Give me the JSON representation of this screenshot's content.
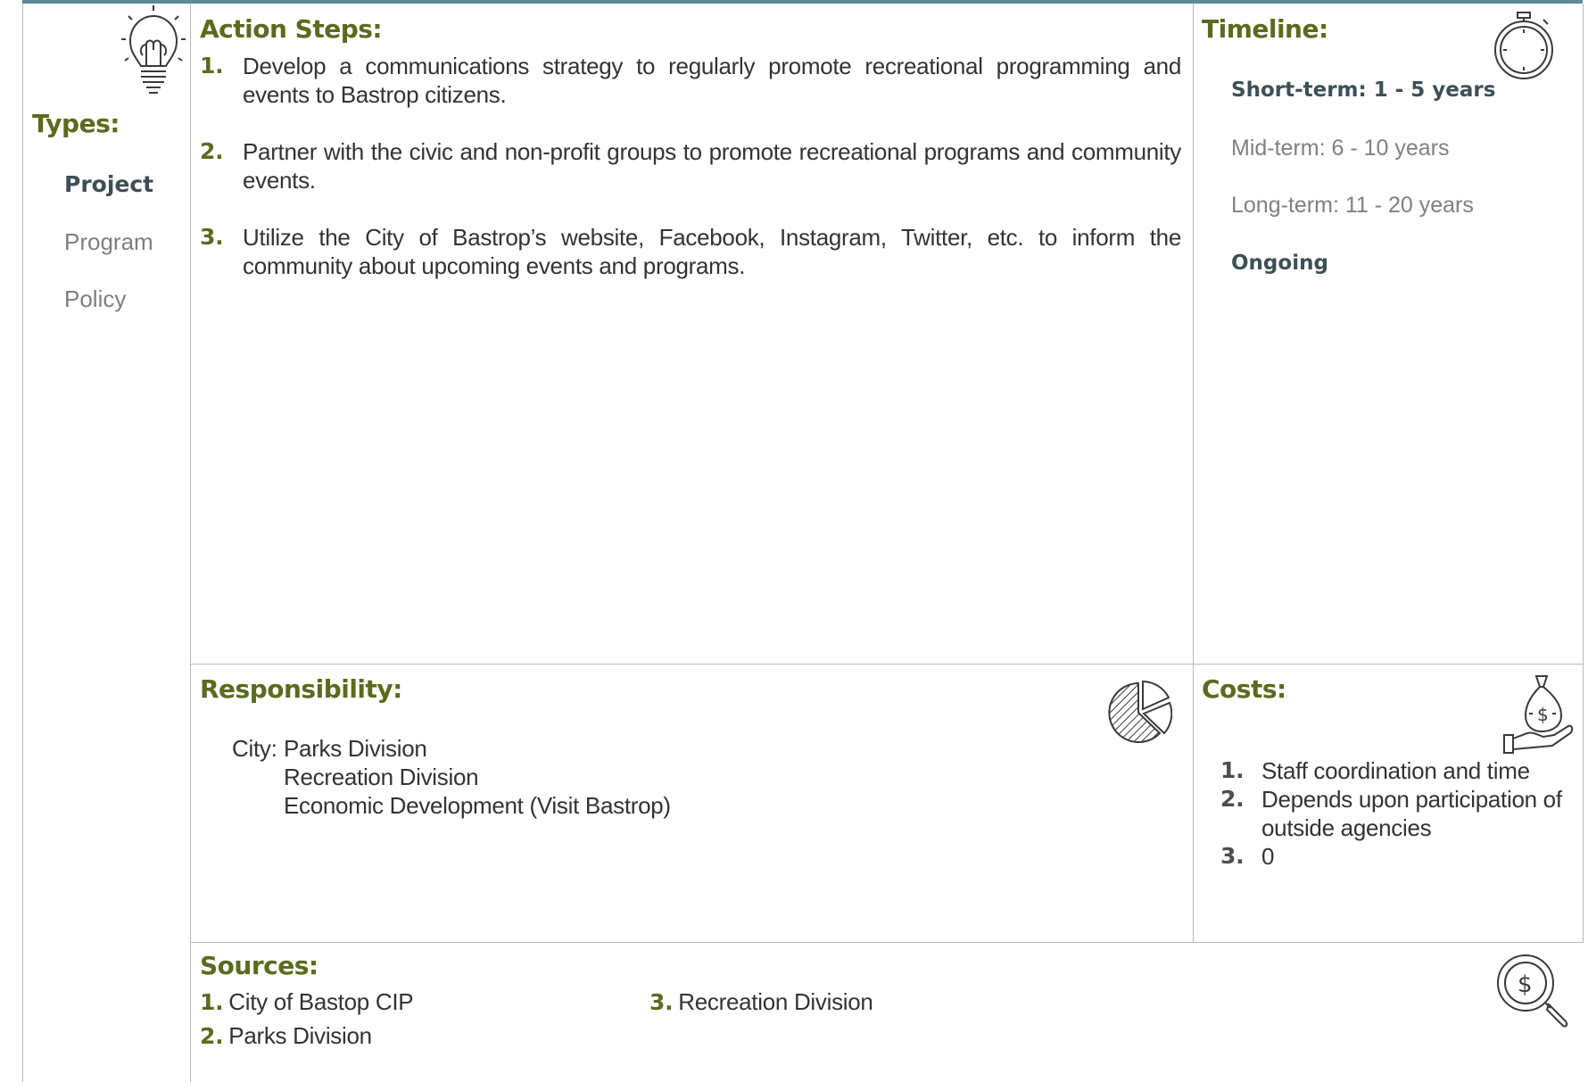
{
  "types": {
    "heading": "Types:",
    "items": [
      {
        "label": "Project",
        "selected": true
      },
      {
        "label": "Program",
        "selected": false
      },
      {
        "label": "Policy",
        "selected": false
      }
    ]
  },
  "action_steps": {
    "heading": "Action Steps:",
    "items": [
      {
        "num": "1.",
        "text": "Develop a communications strategy to regularly promote recreational programming and events to Bastrop citizens."
      },
      {
        "num": "2.",
        "text": "Partner with the civic and non-profit groups to promote recreational programs and community events."
      },
      {
        "num": "3.",
        "text": "Utilize the City of Bastrop’s website, Facebook, Instagram, Twitter, etc. to inform the community about upcoming events and programs."
      }
    ]
  },
  "timeline": {
    "heading": "Timeline:",
    "items": [
      {
        "label": "Short-term:  1 - 5 years",
        "selected": true
      },
      {
        "label": "Mid-term:  6 - 10 years",
        "selected": false
      },
      {
        "label": "Long-term:  11 - 20 years",
        "selected": false
      },
      {
        "label": "Ongoing",
        "selected": true
      }
    ]
  },
  "responsibility": {
    "heading": "Responsibility:",
    "prefix": "City:",
    "items": [
      "Parks Division",
      "Recreation Division",
      "Economic Development (Visit Bastrop)"
    ]
  },
  "costs": {
    "heading": "Costs:",
    "items": [
      {
        "num": "1.",
        "text": "Staff coordination and time"
      },
      {
        "num": "2.",
        "text": "Depends upon participation of outside agencies"
      },
      {
        "num": "3.",
        "text": "0"
      }
    ]
  },
  "sources": {
    "heading": "Sources:",
    "items": [
      {
        "num": "1.",
        "text": "City of Bastop CIP"
      },
      {
        "num": "2.",
        "text": "Parks Division"
      },
      {
        "num": "3.",
        "text": "Recreation Division"
      }
    ]
  },
  "icons": {
    "types": "lightbulb-icon",
    "timeline": "stopwatch-icon",
    "responsibility": "pie-chart-icon",
    "costs": "money-bag-hand-icon",
    "sources": "dollar-search-icon"
  },
  "colors": {
    "heading": "#5a6b1e",
    "selected_text": "#3d4f57",
    "muted_text": "#808080",
    "top_bar": "#5c8a96",
    "rule": "#b9b9b9"
  }
}
